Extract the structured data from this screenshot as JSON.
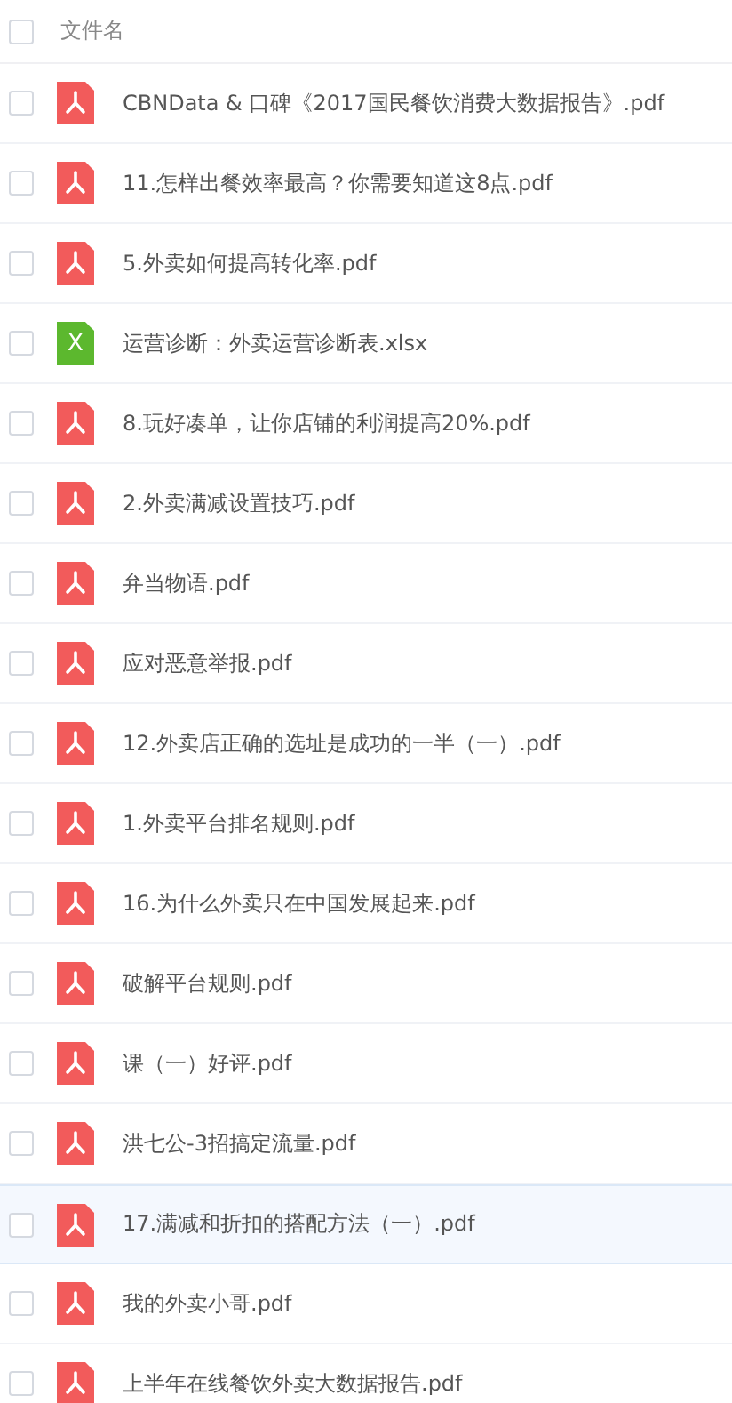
{
  "header": {
    "checked": false,
    "label": "文件名"
  },
  "files": [
    {
      "name": "CBNData & 口碑《2017国民餐饮消费大数据报告》.pdf",
      "kind": "pdf",
      "checked": false,
      "hovered": false
    },
    {
      "name": "11.怎样出餐效率最高？你需要知道这8点.pdf",
      "kind": "pdf",
      "checked": false,
      "hovered": false
    },
    {
      "name": "5.外卖如何提高转化率.pdf",
      "kind": "pdf",
      "checked": false,
      "hovered": false
    },
    {
      "name": "运营诊断：外卖运营诊断表.xlsx",
      "kind": "xlsx",
      "icon_letter": "X",
      "checked": false,
      "hovered": false
    },
    {
      "name": "8.玩好凑单，让你店铺的利润提高20%.pdf",
      "kind": "pdf",
      "checked": false,
      "hovered": false
    },
    {
      "name": "2.外卖满减设置技巧.pdf",
      "kind": "pdf",
      "checked": false,
      "hovered": false
    },
    {
      "name": "弁当物语.pdf",
      "kind": "pdf",
      "checked": false,
      "hovered": false
    },
    {
      "name": "应对恶意举报.pdf",
      "kind": "pdf",
      "checked": false,
      "hovered": false
    },
    {
      "name": "12.外卖店正确的选址是成功的一半（一）.pdf",
      "kind": "pdf",
      "checked": false,
      "hovered": false
    },
    {
      "name": "1.外卖平台排名规则.pdf",
      "kind": "pdf",
      "checked": false,
      "hovered": false
    },
    {
      "name": "16.为什么外卖只在中国发展起来.pdf",
      "kind": "pdf",
      "checked": false,
      "hovered": false
    },
    {
      "name": "破解平台规则.pdf",
      "kind": "pdf",
      "checked": false,
      "hovered": false
    },
    {
      "name": "课（一）好评.pdf",
      "kind": "pdf",
      "checked": false,
      "hovered": false
    },
    {
      "name": "洪七公-3招搞定流量.pdf",
      "kind": "pdf",
      "checked": false,
      "hovered": false
    },
    {
      "name": "17.满减和折扣的搭配方法（一）.pdf",
      "kind": "pdf",
      "checked": false,
      "hovered": true
    },
    {
      "name": "我的外卖小哥.pdf",
      "kind": "pdf",
      "checked": false,
      "hovered": false
    },
    {
      "name": "上半年在线餐饮外卖大数据报告.pdf",
      "kind": "pdf",
      "checked": false,
      "hovered": false
    }
  ]
}
